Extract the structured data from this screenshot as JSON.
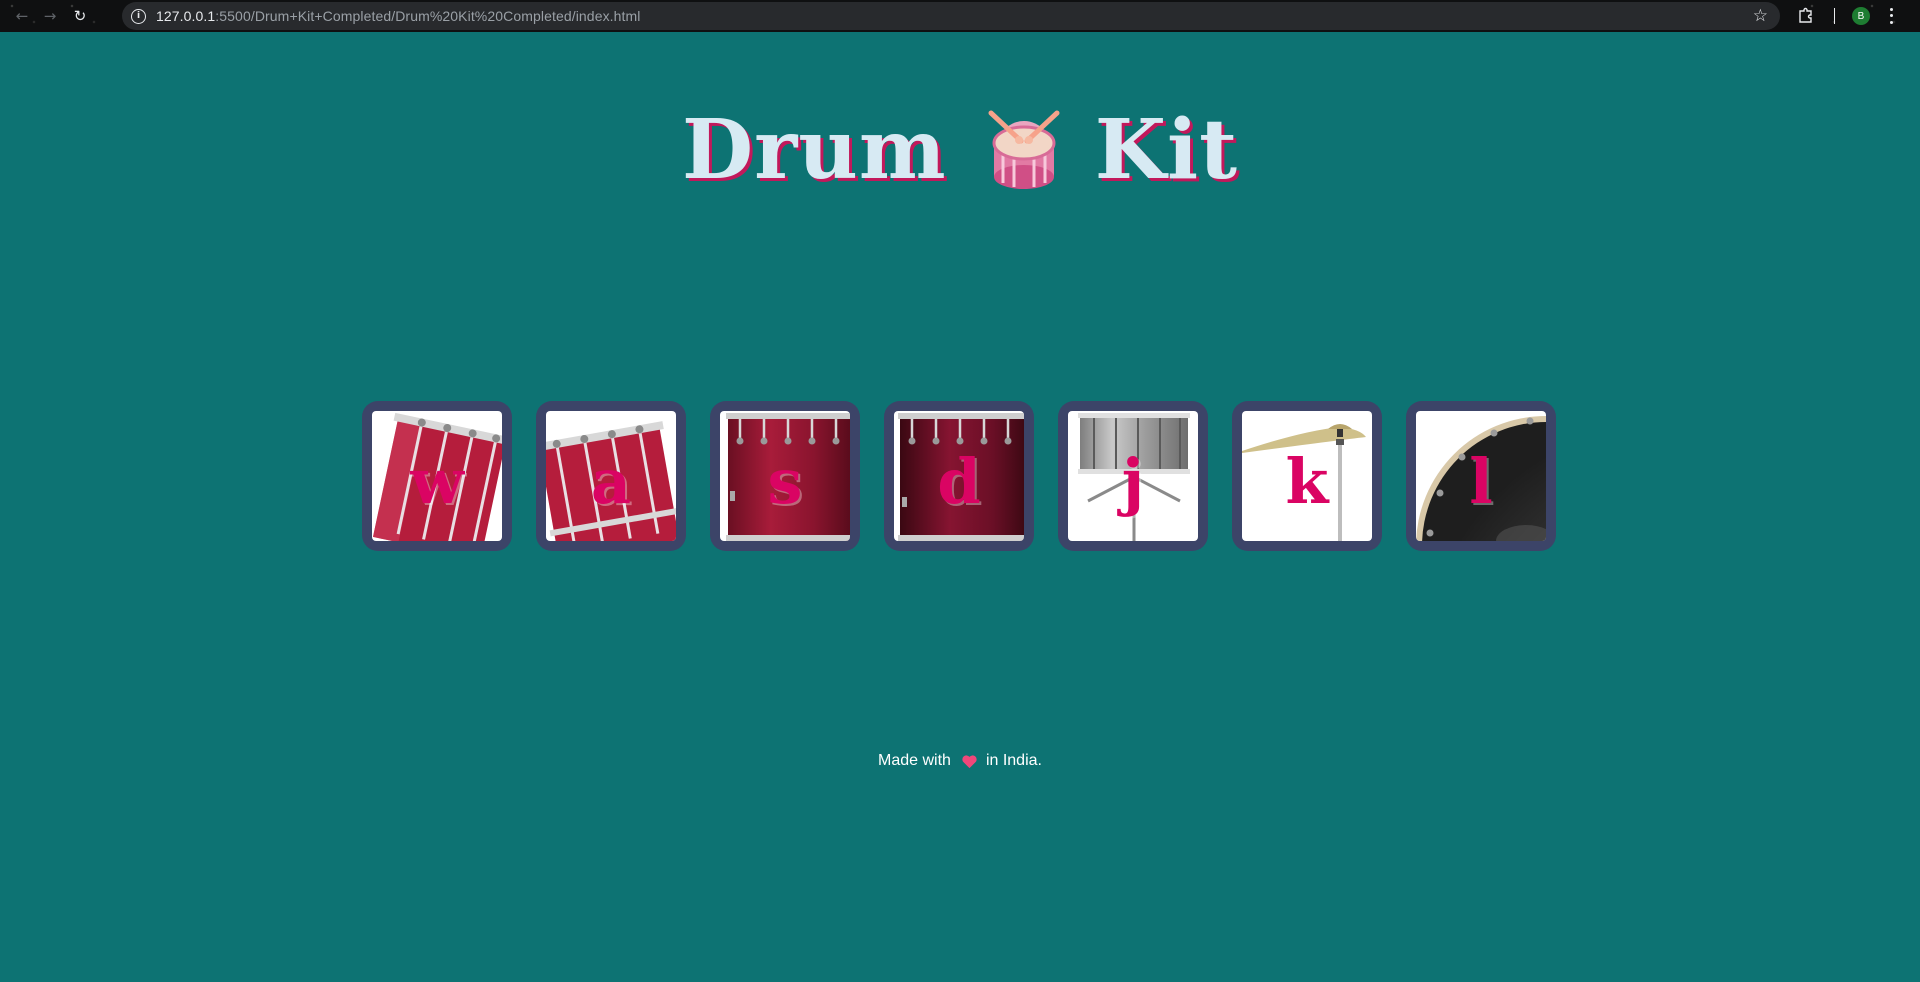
{
  "browser": {
    "url_host": "127.0.0.1",
    "url_rest": ":5500/Drum+Kit+Completed/Drum%20Kit%20Completed/index.html",
    "profile_initial": "B",
    "back_icon": "back-arrow-icon",
    "forward_icon": "forward-arrow-icon",
    "reload_icon": "reload-icon",
    "info_icon": "info-icon",
    "star_icon": "bookmark-star-icon",
    "extensions_icon": "puzzle-icon",
    "menu_icon": "kebab-menu-icon"
  },
  "page": {
    "title_left": "Drum",
    "title_right": "Kit",
    "title_icon": "drum-icon",
    "background_color": "#0d7373",
    "title_color": "#d7eaf3",
    "title_shadow_color": "#c2185b",
    "drum_frame_color": "#3c4468",
    "letter_color": "#da0463"
  },
  "drums": [
    {
      "key": "w",
      "image": "tom-1"
    },
    {
      "key": "a",
      "image": "tom-2"
    },
    {
      "key": "s",
      "image": "tom-3"
    },
    {
      "key": "d",
      "image": "tom-4"
    },
    {
      "key": "j",
      "image": "snare"
    },
    {
      "key": "k",
      "image": "crash"
    },
    {
      "key": "l",
      "image": "kick-bass"
    }
  ],
  "footer": {
    "before": "Made with",
    "icon": "heart-icon",
    "after": "in India."
  }
}
